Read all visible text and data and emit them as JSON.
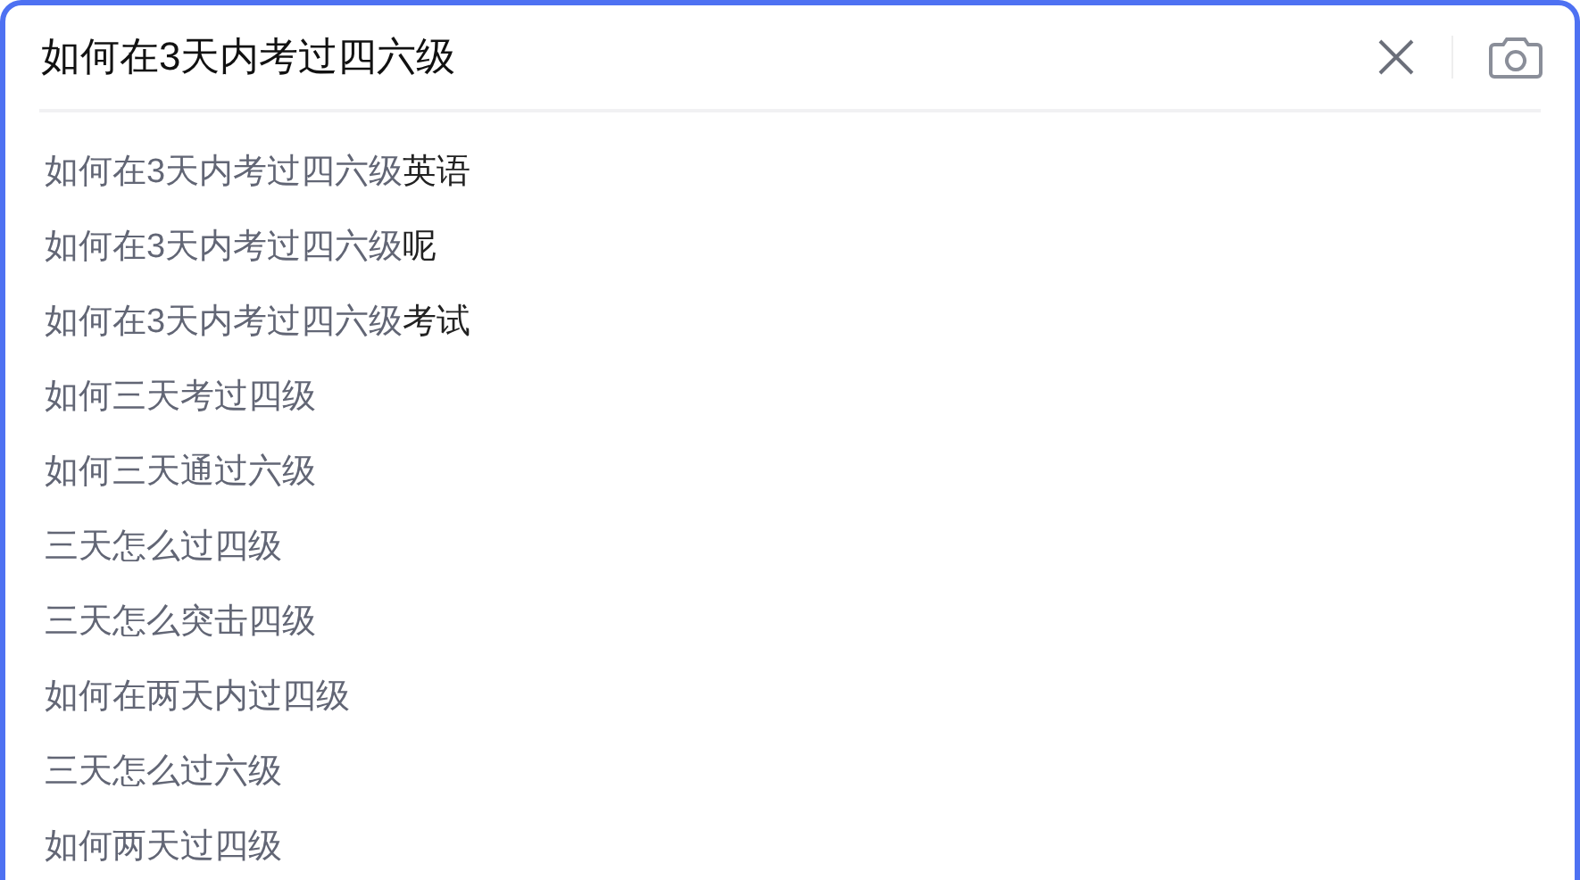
{
  "search": {
    "value": "如何在3天内考过四六级"
  },
  "suggestions": [
    {
      "match": "如何在3天内考过四六级",
      "rest": "英语"
    },
    {
      "match": "如何在3天内考过四六级",
      "rest": "呢"
    },
    {
      "match": "如何在3天内考过四六级",
      "rest": "考试"
    },
    {
      "match": "如何三天考过四级"
    },
    {
      "match": "如何三天通过六级"
    },
    {
      "match": "三天怎么过四级"
    },
    {
      "match": "三天怎么突击四级"
    },
    {
      "match": "如何在两天内过四级"
    },
    {
      "match": "三天怎么过六级"
    },
    {
      "match": "如何两天过四级"
    }
  ]
}
